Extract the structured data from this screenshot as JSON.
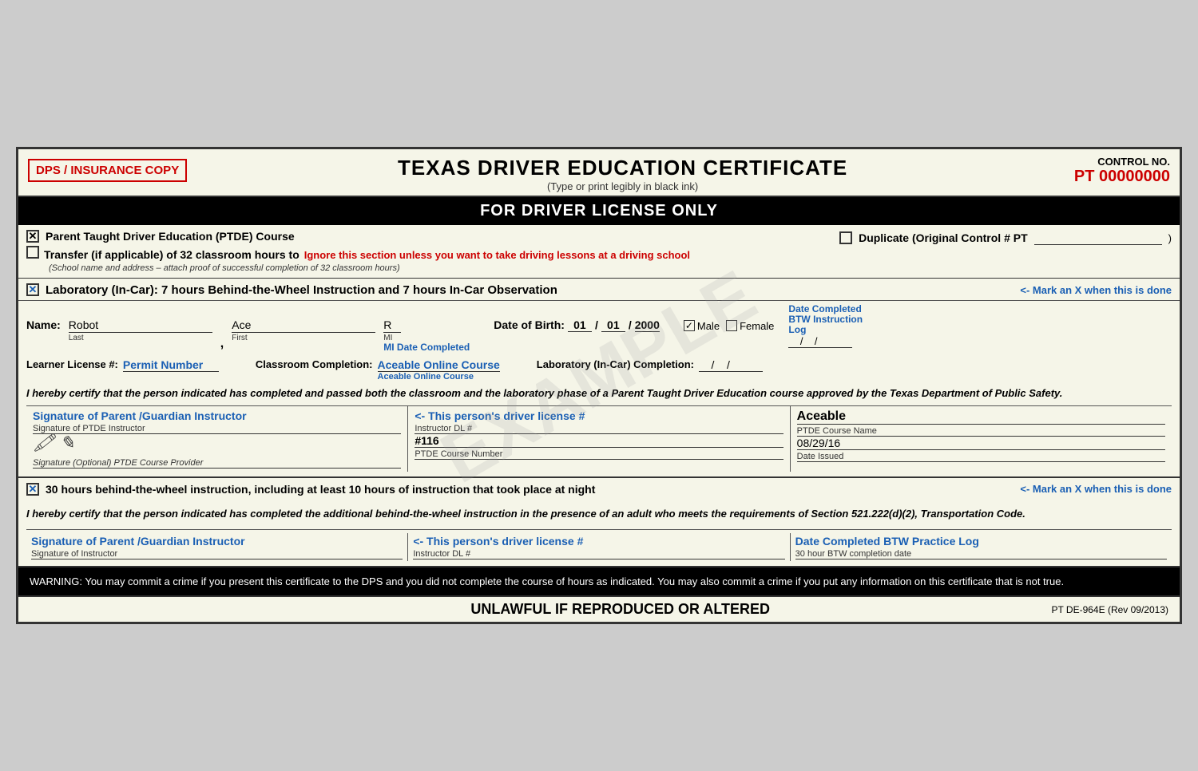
{
  "header": {
    "dps_badge": "DPS / INSURANCE COPY",
    "title": "TEXAS DRIVER EDUCATION CERTIFICATE",
    "subtitle": "(Type or print legibly in black ink)",
    "control_label": "CONTROL NO.",
    "control_number": "PT 00000000"
  },
  "banner": {
    "text": "FOR DRIVER LICENSE ONLY"
  },
  "top_section": {
    "ptde_label": "Parent Taught Driver Education (PTDE) Course",
    "duplicate_label": "Duplicate (Original Control # PT",
    "duplicate_end": ")",
    "transfer_label": "Transfer (if applicable) of 32 classroom hours to",
    "transfer_note": "Ignore this section unless you want to take driving lessons at a driving school",
    "school_note": "(School name and address – attach proof of successful completion of 32 classroom hours)"
  },
  "lab_section": {
    "header_text": "Laboratory (In-Car):  7 hours Behind-the-Wheel Instruction and 7 hours In-Car Observation",
    "mark_note": "<- Mark an X when this is done",
    "name_last": "Robot",
    "name_first": "Ace",
    "name_mi": "R",
    "name_last_label": "Last",
    "name_first_label": "First",
    "name_mi_label": "MI",
    "dob_label": "Date of Birth:",
    "dob_month": "01",
    "dob_day": "01",
    "dob_year": "2000",
    "male_label": "Male",
    "female_label": "Female",
    "mi_date_label": "MI Date Completed",
    "date_completed_label": "Date Completed",
    "learner_label": "Learner License #:",
    "learner_value": "Permit Number",
    "classroom_label": "Classroom Completion:",
    "classroom_value": "Aceable Online Course",
    "lab_completion_label": "Laboratory (In-Car) Completion:",
    "btw_date_label": "Date Completed BTW Instruction Log",
    "certify_text": "I hereby certify that the person indicated has completed and passed both the classroom and the laboratory phase of a Parent Taught Driver Education course approved by the Texas Department of Public Safety.",
    "sig_instructor_label": "Signature of PTDE Instructor",
    "sig_instructor_blue": "Signature of Parent /Guardian Instructor",
    "sig_provider_label": "Signature (Optional) PTDE Course Provider",
    "instructor_dl_label": "Instructor DL #",
    "instructor_dl_blue": "<- This person's driver license #",
    "instructor_dl_value": "#116",
    "ptde_course_number_label": "PTDE Course Number",
    "ptde_course_name_label": "PTDE Course Name",
    "ptde_course_name_value": "Aceable",
    "date_issued_label": "Date Issued",
    "date_issued_value": "08/29/16"
  },
  "btw_section": {
    "header_text": "30 hours behind-the-wheel instruction, including at least 10 hours of instruction that took place at night",
    "mark_note": "<- Mark an X when this is done",
    "certify_text": "I hereby certify that the person indicated has completed the additional behind-the-wheel instruction in the presence of an adult who meets the requirements of Section 521.222(d)(2), Transportation Code.",
    "sig_instructor_label": "Signature of Instructor",
    "sig_instructor_blue": "Signature of Parent /Guardian Instructor",
    "instructor_dl_label": "Instructor DL #",
    "instructor_dl_blue": "<- This person's driver license #",
    "date_completed_label": "30 hour BTW completion date",
    "date_completed_blue": "Date Completed BTW Practice Log"
  },
  "warning": {
    "text": "WARNING: You may commit a crime if you present this certificate to the DPS and you did not complete the course of hours as indicated.  You may also commit a crime if you put any information on this certificate that is not true."
  },
  "footer": {
    "center_text": "UNLAWFUL IF REPRODUCED OR ALTERED",
    "right_text": "PT DE-964E (Rev 09/2013)"
  },
  "watermark": "EXAMPLE"
}
